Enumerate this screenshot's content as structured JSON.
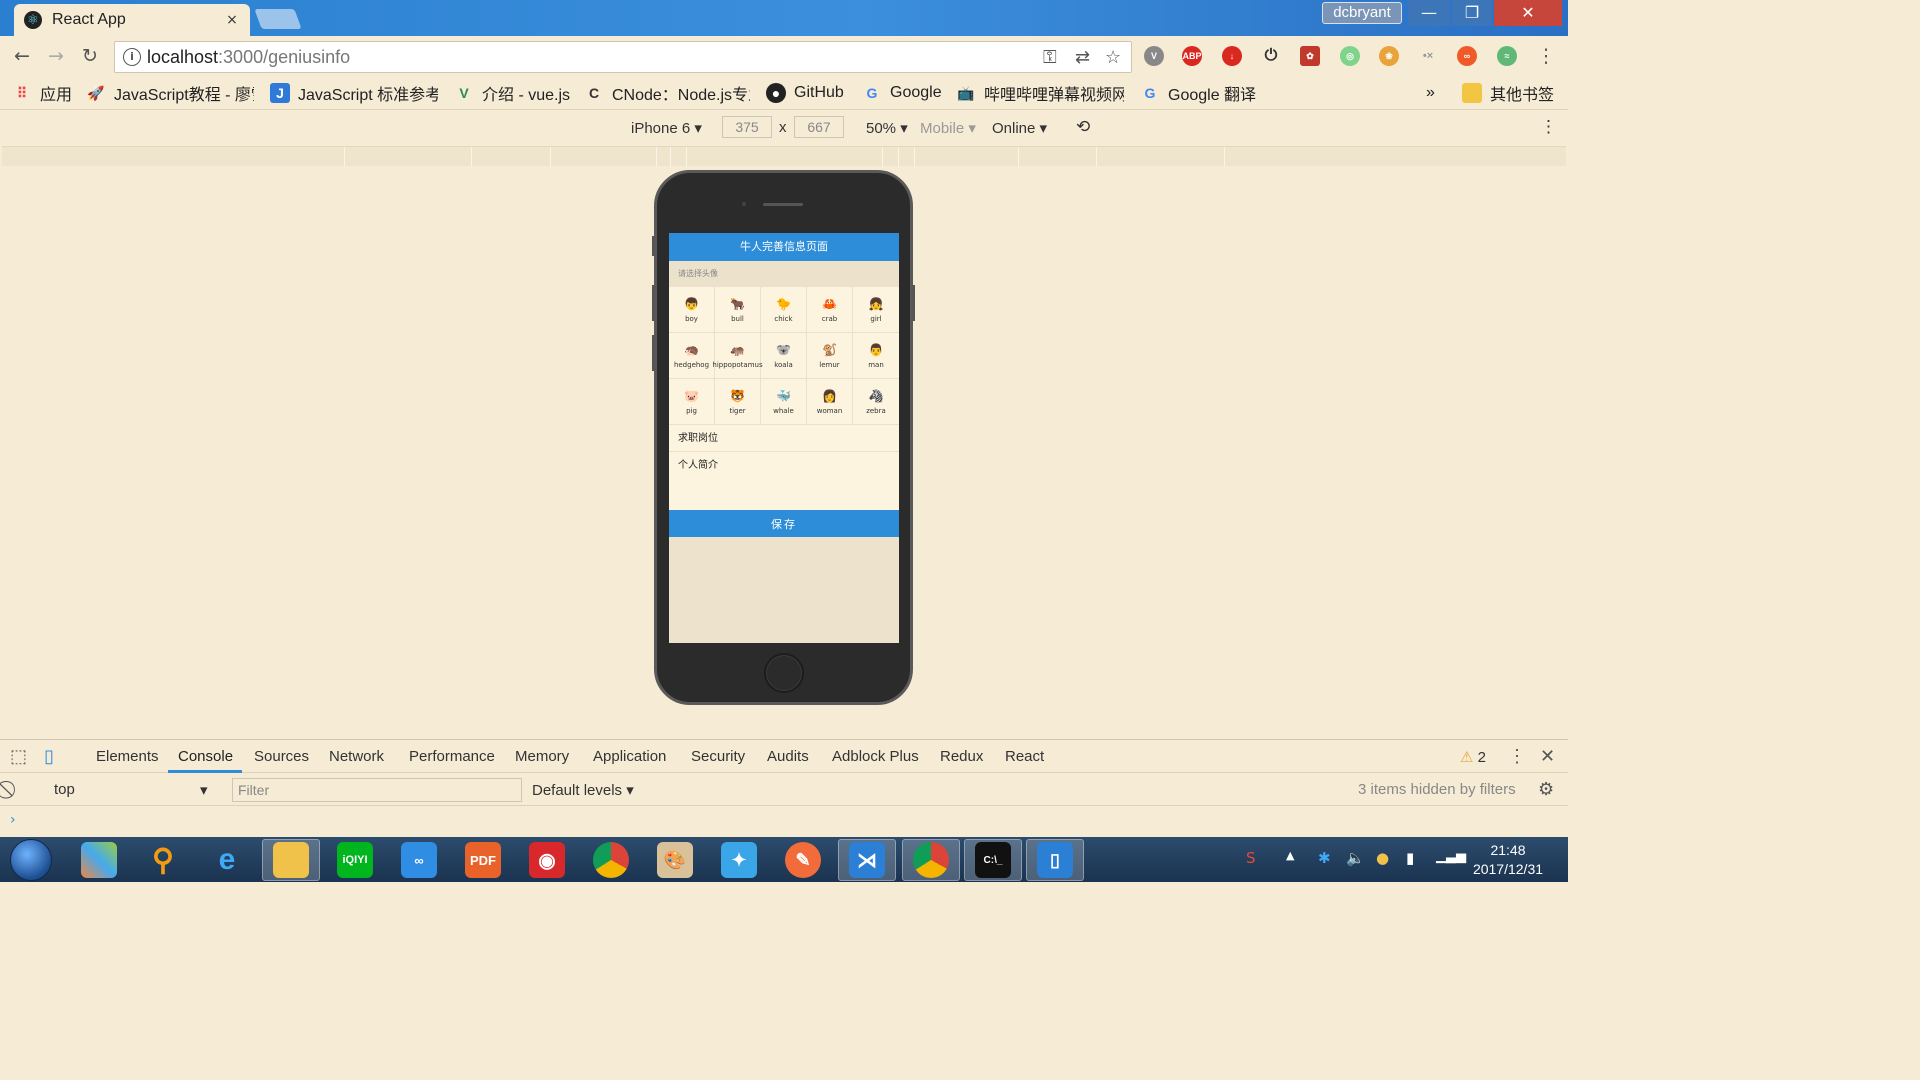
{
  "browser": {
    "tab_title": "React App",
    "tab_close": "×",
    "user_name": "dcbryant",
    "window_buttons": {
      "minimize": "—",
      "maximize": "❐",
      "close": "✕"
    },
    "url_host": "localhost",
    "url_rest": ":3000/geniusinfo",
    "bookmarks": [
      {
        "label": "应用",
        "icon": "apps-icon"
      },
      {
        "label": "JavaScript教程 - 廖雪",
        "icon": "rocket-icon"
      },
      {
        "label": "JavaScript 标准参考教",
        "icon": "j-icon"
      },
      {
        "label": "介绍 - vue.js",
        "icon": "vue-icon"
      },
      {
        "label": "CNode：Node.js专业",
        "icon": "cnode-icon"
      },
      {
        "label": "GitHub",
        "icon": "github-icon"
      },
      {
        "label": "Google",
        "icon": "google-icon"
      },
      {
        "label": "哔哩哔哩弹幕视频网",
        "icon": "bilibili-icon"
      },
      {
        "label": "Google 翻译",
        "icon": "translate-icon"
      }
    ],
    "bookmarks_more": "»",
    "other_bookmarks": "其他书签"
  },
  "device_toolbar": {
    "device": "iPhone 6",
    "width": "375",
    "height": "667",
    "times": "x",
    "zoom": "50%",
    "mode": "Mobile",
    "network": "Online"
  },
  "app": {
    "nav_title": "牛人完善信息页面",
    "avatar_hint": "请选择头像",
    "avatars": [
      {
        "name": "boy",
        "glyph": "👦"
      },
      {
        "name": "bull",
        "glyph": "🐂"
      },
      {
        "name": "chick",
        "glyph": "🐤"
      },
      {
        "name": "crab",
        "glyph": "🦀"
      },
      {
        "name": "girl",
        "glyph": "👧"
      },
      {
        "name": "hedgehog",
        "glyph": "🦔"
      },
      {
        "name": "hippopotamus",
        "glyph": "🦛"
      },
      {
        "name": "koala",
        "glyph": "🐨"
      },
      {
        "name": "lemur",
        "glyph": "🐒"
      },
      {
        "name": "man",
        "glyph": "👨"
      },
      {
        "name": "pig",
        "glyph": "🐷"
      },
      {
        "name": "tiger",
        "glyph": "🐯"
      },
      {
        "name": "whale",
        "glyph": "🐳"
      },
      {
        "name": "woman",
        "glyph": "👩"
      },
      {
        "name": "zebra",
        "glyph": "🦓"
      }
    ],
    "job_label": "求职岗位",
    "intro_label": "个人简介",
    "save_label": "保存"
  },
  "devtools": {
    "tabs": [
      "Elements",
      "Console",
      "Sources",
      "Network",
      "Performance",
      "Memory",
      "Application",
      "Security",
      "Audits",
      "Adblock Plus",
      "Redux",
      "React"
    ],
    "active_tab": "Console",
    "warning_count": "2",
    "context": "top",
    "filter_placeholder": "Filter",
    "levels": "Default levels",
    "hidden_info": "3 items hidden by filters",
    "prompt": "›"
  },
  "taskbar": {
    "time": "21:48",
    "date": "2017/12/31"
  }
}
